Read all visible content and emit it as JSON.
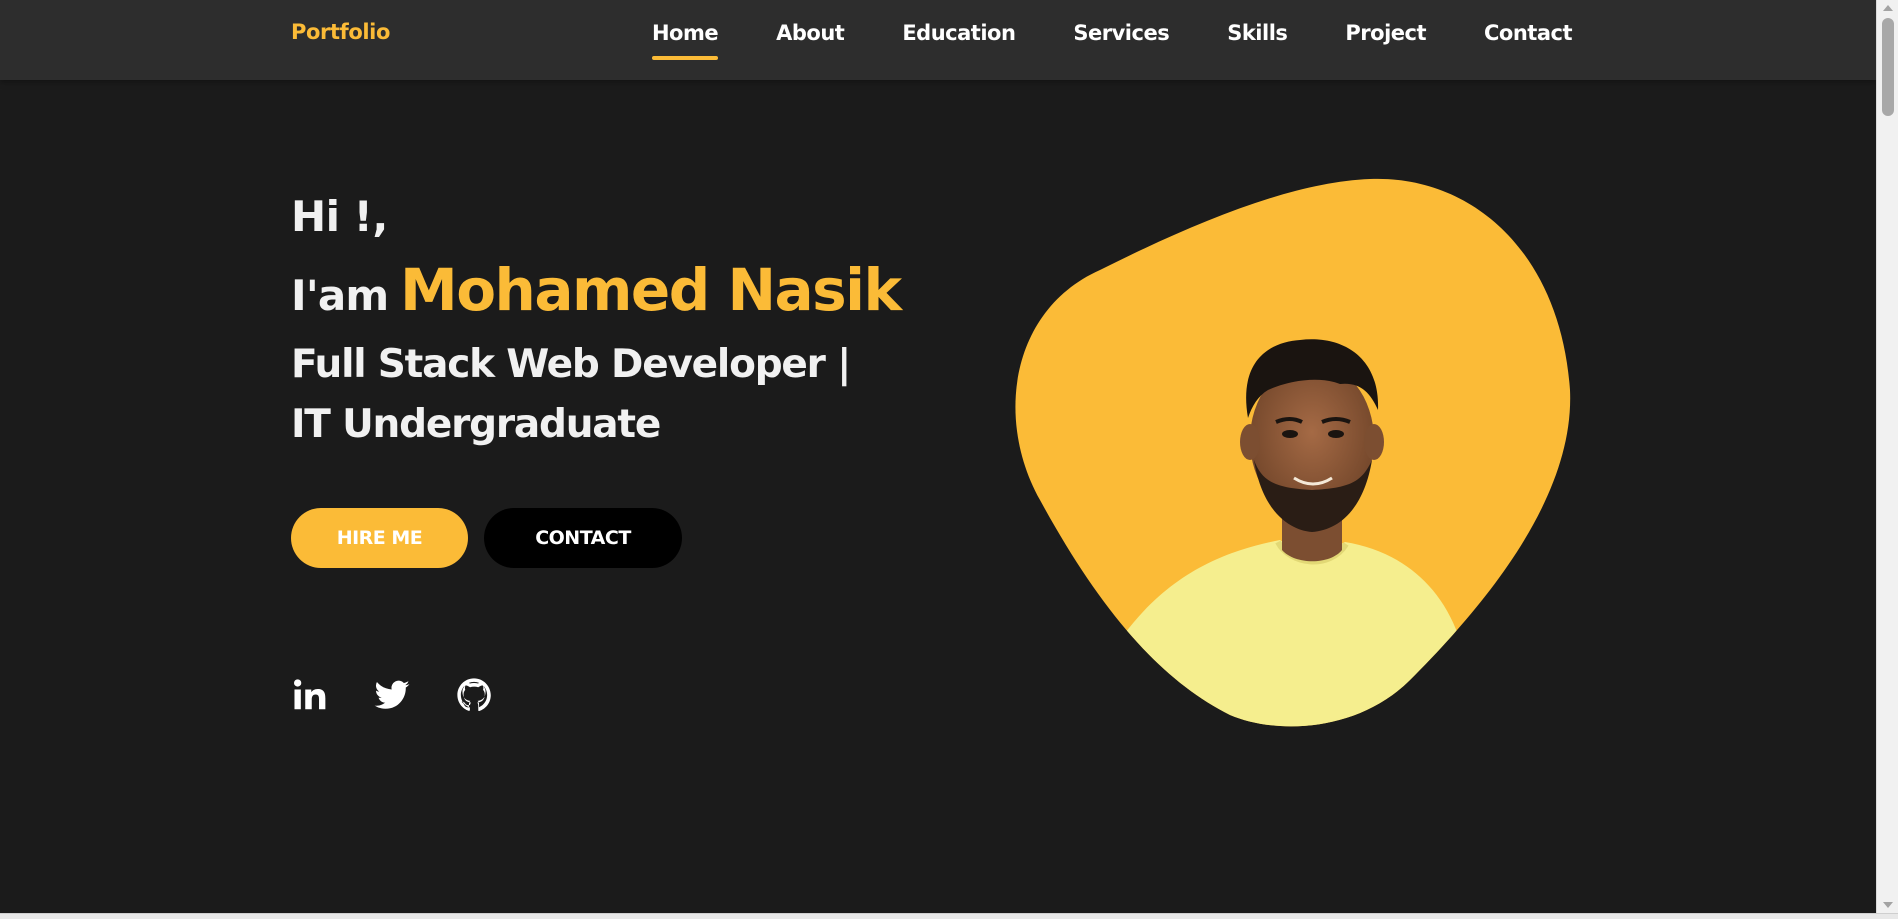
{
  "colors": {
    "accent": "#fbbb37",
    "background": "#1b1b1b",
    "navbar": "#2d2d2d",
    "text": "#f1f1f1"
  },
  "nav": {
    "logo": "Portfolio",
    "links": [
      {
        "label": "Home",
        "active": true
      },
      {
        "label": "About"
      },
      {
        "label": "Education"
      },
      {
        "label": "Services"
      },
      {
        "label": "Skills"
      },
      {
        "label": "Project"
      },
      {
        "label": "Contact"
      }
    ]
  },
  "hero": {
    "greeting": "Hi !,",
    "intro_prefix": "I'am",
    "name": "Mohamed Nasik",
    "role_line1": "Full Stack Web Developer |",
    "role_line2": "IT Undergraduate",
    "hire_button": "HIRE ME",
    "contact_button": "CONTACT",
    "social_icons": [
      "linkedin-icon",
      "twitter-icon",
      "github-icon"
    ],
    "image": "profile-photo"
  }
}
